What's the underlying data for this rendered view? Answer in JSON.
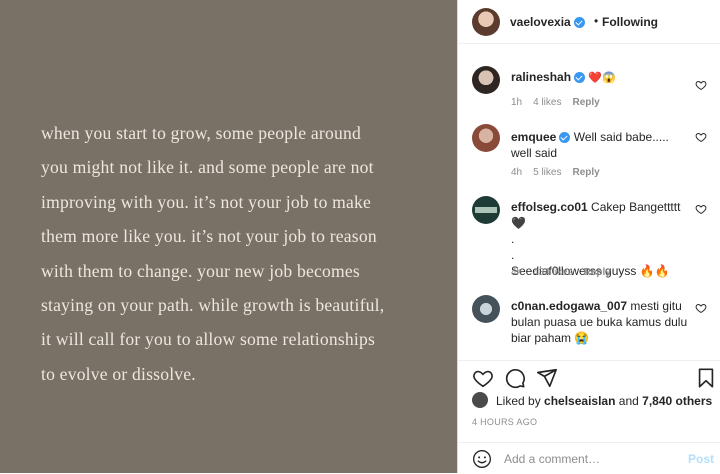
{
  "post": {
    "quote_lines": [
      "when you start to grow, some people around",
      "you might not like it. and some people are not",
      "improving with you. it’s not your job to make",
      "them more like you. it’s not your job to reason",
      "with them to change. your new job becomes",
      "staying on your path. while growth is beautiful,",
      "it will call for you to allow some relationships",
      "to evolve or dissolve."
    ],
    "background": "#7a7166"
  },
  "header": {
    "username": "vaelovexia",
    "dot": "•",
    "follow_label": "Following"
  },
  "comments": [
    {
      "user": "ralineshah",
      "text": "❤️😱",
      "time": "1h",
      "likes": "4 likes",
      "reply": "Reply"
    },
    {
      "user": "emquee",
      "text": "Well said babe..... well said",
      "time": "4h",
      "likes": "5 likes",
      "reply": "Reply"
    },
    {
      "user": "effolseg.co01",
      "text": "Cakep Bangettttt🖤",
      "text2": ".",
      "text3": ".",
      "text4": "Seediaf0llowerss guyss 🔥🔥",
      "time": "4h",
      "likes": "434 likes",
      "reply": "Reply"
    },
    {
      "user": "c0nan.edogawa_007",
      "text": "mesti gitu bulan puasa ue buka kamus dulu biar paham 😭"
    }
  ],
  "likes": {
    "prefix": "Liked by",
    "user": "chelseaislan",
    "connector": "and",
    "others": "7,840 others"
  },
  "timestamp": "4 HOURS AGO",
  "add_comment": {
    "placeholder": "Add a comment…",
    "post_label": "Post"
  },
  "colors": {
    "verified": "#3897f0",
    "like_red": "#ed4956",
    "post_disabled": "#b2dffc"
  }
}
